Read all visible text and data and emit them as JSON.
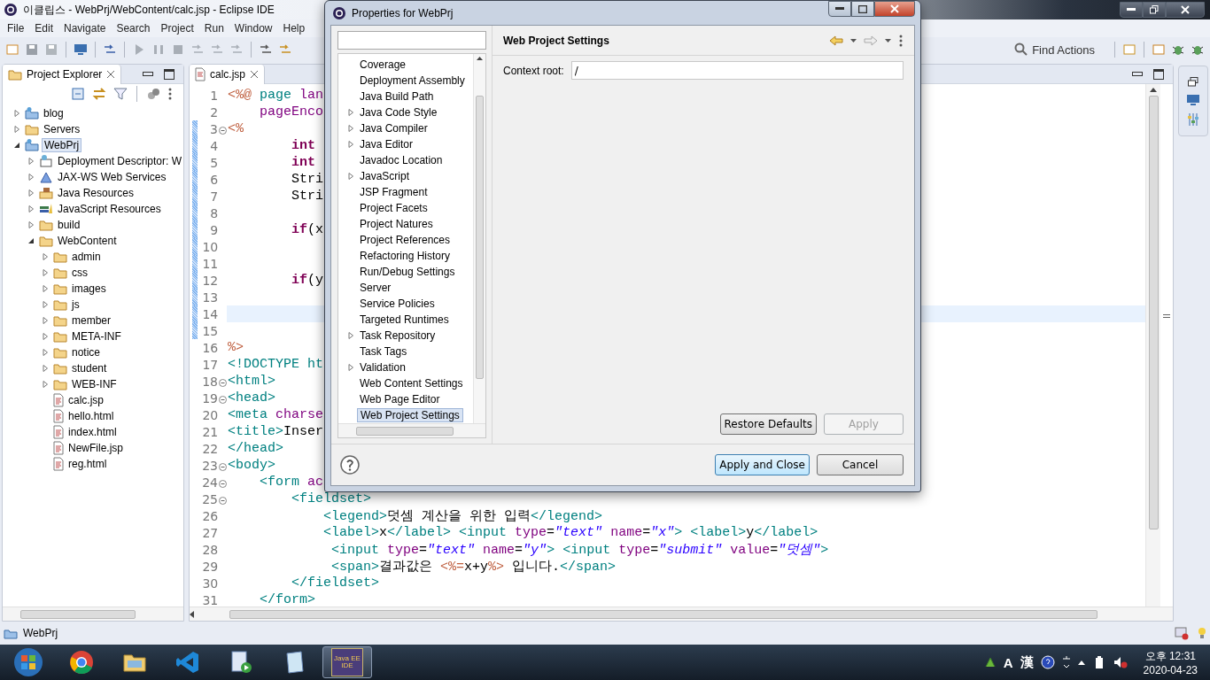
{
  "window": {
    "title": "이클립스 - WebPrj/WebContent/calc.jsp - Eclipse IDE"
  },
  "menu": [
    "File",
    "Edit",
    "Navigate",
    "Search",
    "Project",
    "Run",
    "Window",
    "Help"
  ],
  "find_actions": "Find Actions",
  "explorer": {
    "title": "Project Explorer",
    "items": [
      {
        "label": "blog",
        "kind": "project",
        "expanded": false,
        "selected": false
      },
      {
        "label": "Servers",
        "kind": "folder",
        "expanded": false,
        "selected": false
      },
      {
        "label": "WebPrj",
        "kind": "project",
        "expanded": true,
        "selected": true,
        "children": [
          {
            "label": "Deployment Descriptor: W",
            "kind": "descriptor",
            "expanded": false,
            "selected": false
          },
          {
            "label": "JAX-WS Web Services",
            "kind": "service",
            "expanded": false,
            "selected": false
          },
          {
            "label": "Java Resources",
            "kind": "resources",
            "expanded": false,
            "selected": false
          },
          {
            "label": "JavaScript Resources",
            "kind": "library",
            "expanded": false,
            "selected": false
          },
          {
            "label": "build",
            "kind": "folder",
            "expanded": false,
            "selected": false
          },
          {
            "label": "WebContent",
            "kind": "folder",
            "expanded": true,
            "selected": false,
            "children": [
              {
                "label": "admin",
                "kind": "folder",
                "expanded": false,
                "selected": false
              },
              {
                "label": "css",
                "kind": "folder",
                "expanded": false,
                "selected": false
              },
              {
                "label": "images",
                "kind": "folder",
                "expanded": false,
                "selected": false
              },
              {
                "label": "js",
                "kind": "folder",
                "expanded": false,
                "selected": false
              },
              {
                "label": "member",
                "kind": "folder",
                "expanded": false,
                "selected": false
              },
              {
                "label": "META-INF",
                "kind": "folder",
                "expanded": false,
                "selected": false
              },
              {
                "label": "notice",
                "kind": "folder",
                "expanded": false,
                "selected": false
              },
              {
                "label": "student",
                "kind": "folder",
                "expanded": false,
                "selected": false
              },
              {
                "label": "WEB-INF",
                "kind": "folder",
                "expanded": false,
                "selected": false
              },
              {
                "label": "calc.jsp",
                "kind": "file",
                "selected": false
              },
              {
                "label": "hello.html",
                "kind": "file",
                "selected": false
              },
              {
                "label": "index.html",
                "kind": "file",
                "selected": false
              },
              {
                "label": "NewFile.jsp",
                "kind": "file",
                "selected": false
              },
              {
                "label": "reg.html",
                "kind": "file",
                "selected": false
              }
            ]
          }
        ]
      }
    ]
  },
  "editor": {
    "tab": "calc.jsp",
    "lines": [
      {
        "n": "1",
        "fold": false,
        "changed": false,
        "current": false,
        "segs": [
          {
            "kind": "jsp",
            "text": "<%@"
          },
          {
            "kind": "tag",
            "text": " page"
          },
          {
            "kind": "attr",
            "text": " lan"
          }
        ]
      },
      {
        "n": "2",
        "fold": false,
        "changed": false,
        "current": false,
        "segs": [
          {
            "kind": "attr",
            "text": "    pageEnco"
          }
        ]
      },
      {
        "n": "3",
        "fold": true,
        "changed": true,
        "current": false,
        "segs": [
          {
            "kind": "jsp",
            "text": "<%"
          }
        ]
      },
      {
        "n": "4",
        "fold": false,
        "changed": true,
        "current": false,
        "segs": [
          {
            "kind": "kw",
            "text": "        int"
          }
        ]
      },
      {
        "n": "5",
        "fold": false,
        "changed": true,
        "current": false,
        "segs": [
          {
            "kind": "kw",
            "text": "        int"
          }
        ]
      },
      {
        "n": "6",
        "fold": false,
        "changed": true,
        "current": false,
        "segs": [
          {
            "kind": "plain",
            "text": "        Stri"
          }
        ]
      },
      {
        "n": "7",
        "fold": false,
        "changed": true,
        "current": false,
        "segs": [
          {
            "kind": "plain",
            "text": "        Stri"
          }
        ]
      },
      {
        "n": "8",
        "fold": false,
        "changed": true,
        "current": false
      },
      {
        "n": "9",
        "fold": false,
        "changed": true,
        "current": false,
        "segs": [
          {
            "kind": "kw",
            "text": "        if"
          },
          {
            "kind": "plain",
            "text": "(x"
          }
        ]
      },
      {
        "n": "10",
        "fold": false,
        "changed": true,
        "current": false
      },
      {
        "n": "11",
        "fold": false,
        "changed": true,
        "current": false
      },
      {
        "n": "12",
        "fold": false,
        "changed": true,
        "current": false,
        "segs": [
          {
            "kind": "kw",
            "text": "        if"
          },
          {
            "kind": "plain",
            "text": "(y"
          }
        ]
      },
      {
        "n": "13",
        "fold": false,
        "changed": true,
        "current": false
      },
      {
        "n": "14",
        "fold": false,
        "changed": true,
        "current": true
      },
      {
        "n": "15",
        "fold": false,
        "changed": true,
        "current": false
      },
      {
        "n": "16",
        "fold": false,
        "changed": false,
        "current": false,
        "segs": [
          {
            "kind": "jsp",
            "text": "%>"
          }
        ]
      },
      {
        "n": "17",
        "fold": false,
        "changed": false,
        "current": false,
        "segs": [
          {
            "kind": "tag",
            "text": "<!DOCTYPE ht"
          }
        ]
      },
      {
        "n": "18",
        "fold": true,
        "changed": false,
        "current": false,
        "segs": [
          {
            "kind": "tag",
            "text": "<html>"
          }
        ]
      },
      {
        "n": "19",
        "fold": true,
        "changed": false,
        "current": false,
        "segs": [
          {
            "kind": "tag",
            "text": "<head>"
          }
        ]
      },
      {
        "n": "20",
        "fold": false,
        "changed": false,
        "current": false,
        "segs": [
          {
            "kind": "tag",
            "text": "<meta"
          },
          {
            "kind": "attr",
            "text": " charse"
          }
        ]
      },
      {
        "n": "21",
        "fold": false,
        "changed": false,
        "current": false,
        "segs": [
          {
            "kind": "tag",
            "text": "<title>"
          },
          {
            "kind": "plain",
            "text": "Inser"
          }
        ]
      },
      {
        "n": "22",
        "fold": false,
        "changed": false,
        "current": false,
        "segs": [
          {
            "kind": "tag",
            "text": "</head>"
          }
        ]
      },
      {
        "n": "23",
        "fold": true,
        "changed": false,
        "current": false,
        "segs": [
          {
            "kind": "tag",
            "text": "<body>"
          }
        ]
      },
      {
        "n": "24",
        "fold": true,
        "changed": false,
        "current": false,
        "segs": [
          {
            "kind": "tag",
            "text": "    <form"
          },
          {
            "kind": "attr",
            "text": " ac"
          }
        ]
      },
      {
        "n": "25",
        "fold": true,
        "changed": false,
        "current": false,
        "segs": [
          {
            "kind": "tag",
            "text": "        <fieldset>"
          }
        ]
      },
      {
        "n": "26",
        "fold": false,
        "changed": false,
        "current": false,
        "segs": [
          {
            "kind": "tag",
            "text": "            <legend>"
          },
          {
            "kind": "plain",
            "text": "덧셈 계산을 위한 입력"
          },
          {
            "kind": "tag",
            "text": "</legend>"
          }
        ]
      },
      {
        "n": "27",
        "fold": false,
        "changed": false,
        "current": false,
        "segs": [
          {
            "kind": "tag",
            "text": "            <label>"
          },
          {
            "kind": "plain",
            "text": "x"
          },
          {
            "kind": "tag",
            "text": "</label> <input"
          },
          {
            "kind": "attr",
            "text": " type"
          },
          {
            "kind": "plain",
            "text": "="
          },
          {
            "kind": "string",
            "text": "\"text\""
          },
          {
            "kind": "attr",
            "text": " name"
          },
          {
            "kind": "plain",
            "text": "="
          },
          {
            "kind": "string",
            "text": "\"x\""
          },
          {
            "kind": "tag",
            "text": "> <label>"
          },
          {
            "kind": "plain",
            "text": "y"
          },
          {
            "kind": "tag",
            "text": "</label>"
          }
        ]
      },
      {
        "n": "28",
        "fold": false,
        "changed": false,
        "current": false,
        "segs": [
          {
            "kind": "tag",
            "text": "             <input"
          },
          {
            "kind": "attr",
            "text": " type"
          },
          {
            "kind": "plain",
            "text": "="
          },
          {
            "kind": "string",
            "text": "\"text\""
          },
          {
            "kind": "attr",
            "text": " name"
          },
          {
            "kind": "plain",
            "text": "="
          },
          {
            "kind": "string",
            "text": "\"y\""
          },
          {
            "kind": "tag",
            "text": "> <input"
          },
          {
            "kind": "attr",
            "text": " type"
          },
          {
            "kind": "plain",
            "text": "="
          },
          {
            "kind": "string",
            "text": "\"submit\""
          },
          {
            "kind": "attr",
            "text": " value"
          },
          {
            "kind": "plain",
            "text": "="
          },
          {
            "kind": "string",
            "text": "\"덧셈\""
          },
          {
            "kind": "tag",
            "text": ">"
          }
        ]
      },
      {
        "n": "29",
        "fold": false,
        "changed": false,
        "current": false,
        "segs": [
          {
            "kind": "tag",
            "text": "             <span>"
          },
          {
            "kind": "plain",
            "text": "결과값은 "
          },
          {
            "kind": "jsp",
            "text": "<%="
          },
          {
            "kind": "plain",
            "text": "x+y"
          },
          {
            "kind": "jsp",
            "text": "%>"
          },
          {
            "kind": "plain",
            "text": " 입니다."
          },
          {
            "kind": "tag",
            "text": "</span>"
          }
        ]
      },
      {
        "n": "30",
        "fold": false,
        "changed": false,
        "current": false,
        "segs": [
          {
            "kind": "tag",
            "text": "        </fieldset>"
          }
        ]
      },
      {
        "n": "31",
        "fold": false,
        "changed": false,
        "current": false,
        "segs": [
          {
            "kind": "tag",
            "text": "    </form>"
          }
        ]
      }
    ]
  },
  "status_bar": {
    "text": "WebPrj"
  },
  "dialog": {
    "title": "Properties for WebPrj",
    "pages": [
      {
        "label": "Coverage",
        "kind": "leaf",
        "selected": false
      },
      {
        "label": "Deployment Assembly",
        "kind": "leaf",
        "selected": false
      },
      {
        "label": "Java Build Path",
        "kind": "leaf",
        "selected": false
      },
      {
        "label": "Java Code Style",
        "kind": "branch",
        "selected": false
      },
      {
        "label": "Java Compiler",
        "kind": "branch",
        "selected": false
      },
      {
        "label": "Java Editor",
        "kind": "branch",
        "selected": false
      },
      {
        "label": "Javadoc Location",
        "kind": "leaf",
        "selected": false
      },
      {
        "label": "JavaScript",
        "kind": "branch",
        "selected": false
      },
      {
        "label": "JSP Fragment",
        "kind": "leaf",
        "selected": false
      },
      {
        "label": "Project Facets",
        "kind": "leaf",
        "selected": false
      },
      {
        "label": "Project Natures",
        "kind": "leaf",
        "selected": false
      },
      {
        "label": "Project References",
        "kind": "leaf",
        "selected": false
      },
      {
        "label": "Refactoring History",
        "kind": "leaf",
        "selected": false
      },
      {
        "label": "Run/Debug Settings",
        "kind": "leaf",
        "selected": false
      },
      {
        "label": "Server",
        "kind": "leaf",
        "selected": false
      },
      {
        "label": "Service Policies",
        "kind": "leaf",
        "selected": false
      },
      {
        "label": "Targeted Runtimes",
        "kind": "leaf",
        "selected": false
      },
      {
        "label": "Task Repository",
        "kind": "branch",
        "selected": false
      },
      {
        "label": "Task Tags",
        "kind": "leaf",
        "selected": false
      },
      {
        "label": "Validation",
        "kind": "branch",
        "selected": false
      },
      {
        "label": "Web Content Settings",
        "kind": "leaf",
        "selected": false
      },
      {
        "label": "Web Page Editor",
        "kind": "leaf",
        "selected": false
      },
      {
        "label": "Web Project Settings",
        "kind": "leaf",
        "selected": true
      }
    ],
    "page_title": "Web Project Settings",
    "context_root": {
      "label": "Context root:",
      "value": "/"
    },
    "buttons": [
      {
        "label": "Restore Defaults",
        "disabled": false,
        "default": false
      },
      {
        "label": "Apply",
        "disabled": true,
        "default": false
      }
    ],
    "footer_buttons": [
      {
        "label": "Apply and Close",
        "disabled": false,
        "default": true
      },
      {
        "label": "Cancel",
        "disabled": false,
        "default": false
      }
    ]
  },
  "taskbar": {
    "active_app_label": [
      "Java EE",
      "IDE"
    ],
    "tray": [
      "A",
      "漢"
    ],
    "time": "오후 12:31",
    "date": "2020-04-23"
  }
}
